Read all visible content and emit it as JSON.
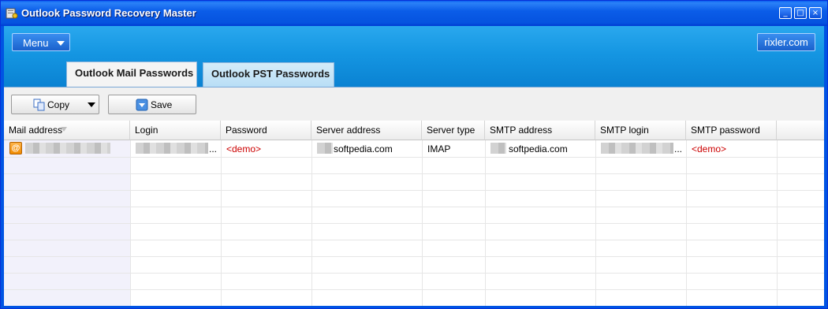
{
  "window": {
    "title": "Outlook Password Recovery Master",
    "controls": {
      "minimize": "_",
      "maximize": "□",
      "close": "×"
    }
  },
  "header": {
    "menu_label": "Menu",
    "site_label": "rixler.com"
  },
  "tabs": [
    {
      "label": "Outlook Mail Passwords",
      "active": true
    },
    {
      "label": "Outlook PST Passwords",
      "active": false
    }
  ],
  "toolbar": {
    "copy_label": "Copy",
    "save_label": "Save"
  },
  "table": {
    "columns": [
      "Mail address",
      "Login",
      "Password",
      "Server address",
      "Server type",
      "SMTP address",
      "SMTP login",
      "SMTP password"
    ],
    "rows": [
      {
        "icon": "@",
        "mail_address": "",
        "login": "...",
        "password": "<demo>",
        "server_address": "softpedia.com",
        "server_type": "IMAP",
        "smtp_address": "softpedia.com",
        "smtp_login": "...",
        "smtp_password": "<demo>"
      }
    ]
  },
  "colors": {
    "accent": "#1596e2",
    "titlebar": "#0553df",
    "demo_text": "#cc0000"
  },
  "icons": [
    "app-key-icon",
    "dropdown-arrow-icon",
    "copy-icon",
    "save-icon",
    "sort-indicator-icon",
    "email-account-icon"
  ]
}
